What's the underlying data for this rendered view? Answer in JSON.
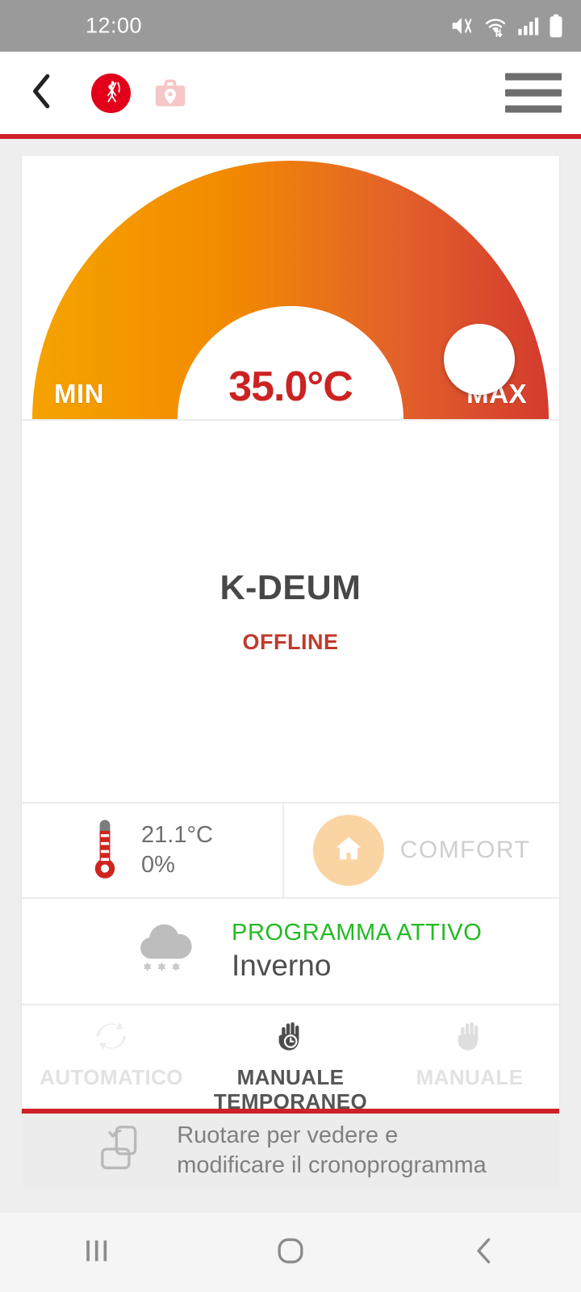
{
  "statusbar": {
    "time": "12:00",
    "icons": [
      "mute-vibrate-icon",
      "wifi-icon",
      "signal-icon",
      "battery-icon"
    ]
  },
  "appbar": {
    "back_icon": "chevron-left-icon",
    "logo_name": "fantini-cosmi-logo",
    "plant_icon": "briefcase-location-icon",
    "menu_icon": "hamburger-menu-icon",
    "accent_color": "#cf2026"
  },
  "gauge": {
    "min_label": "MIN",
    "max_label": "MAX",
    "setpoint": "35.0°C",
    "setpoint_value": 35.0,
    "start_color": "#f5a300",
    "end_color": "#d93c2b",
    "temp_color": "#cc2222",
    "thumb_name": "gauge-thumb"
  },
  "device": {
    "name": "K-DEUM",
    "status": "OFFLINE",
    "status_color": "#c0392b"
  },
  "stats": {
    "thermometer_icon": "thermometer-icon",
    "temperature": "21.1°C",
    "humidity": "0%",
    "comfort_icon": "house-icon",
    "comfort_label": "COMFORT",
    "comfort_circle_color": "#fbd4a4"
  },
  "program": {
    "weather_icon": "snow-cloud-icon",
    "active_label": "PROGRAMMA ATTIVO",
    "active_color": "#22bb22",
    "name": "Inverno"
  },
  "modes": [
    {
      "label": "AUTOMATICO",
      "icon": "auto-cycle-icon",
      "active": false
    },
    {
      "label": "MANUALE\nTEMPORANEO",
      "line1": "MANUALE",
      "line2": "TEMPORANEO",
      "icon": "hand-clock-icon",
      "active": true
    },
    {
      "label": "MANUALE",
      "icon": "hand-icon",
      "active": false
    }
  ],
  "hint": {
    "icon": "rotate-device-icon",
    "line1": "Ruotare per vedere e",
    "line2": "modificare il cronoprogramma"
  },
  "navbar": {
    "recents_icon": "recents-icon",
    "home_icon": "home-icon",
    "back_icon": "back-icon"
  }
}
